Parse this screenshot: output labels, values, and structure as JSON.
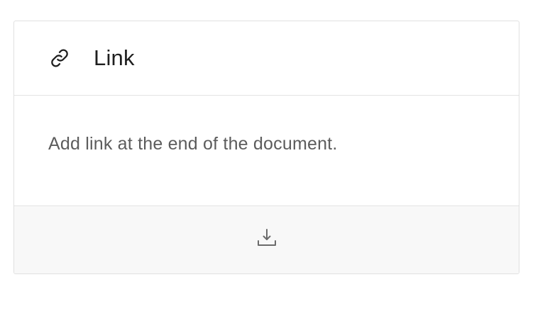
{
  "card": {
    "icon": "link-icon",
    "title": "Link",
    "description": "Add link at the end of the document.",
    "footer_action_icon": "download-icon"
  },
  "colors": {
    "title": "#1f1f1f",
    "description": "#5c5c5c",
    "border": "#e3e3e3",
    "footer_bg": "#f8f8f8",
    "icon": "#1f1f1f",
    "footer_icon": "#6b6b6b"
  }
}
